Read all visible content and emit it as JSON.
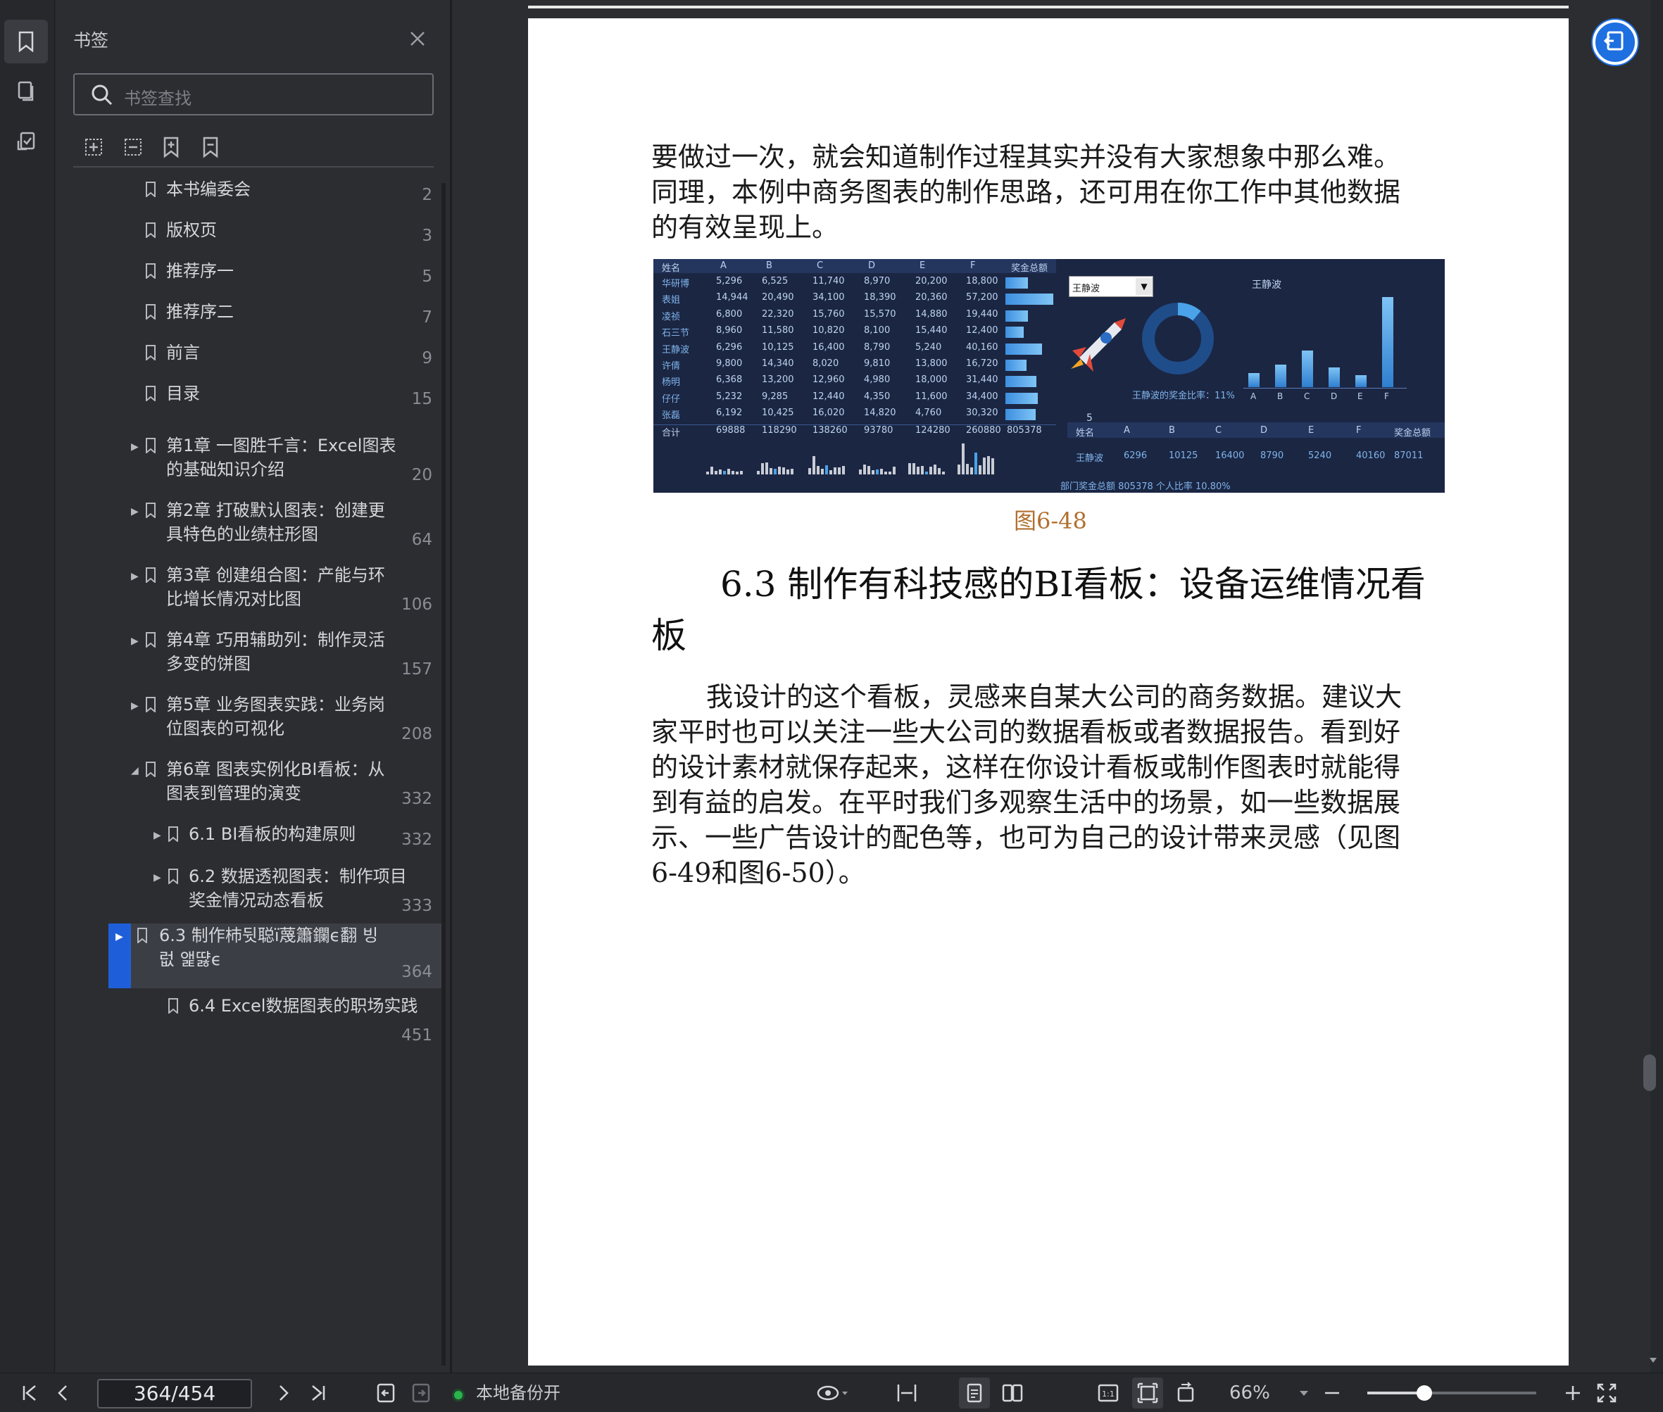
{
  "sidebar": {
    "title": "书签",
    "search_placeholder": "书签查找",
    "items": [
      {
        "label": "本书编委会",
        "page": "2"
      },
      {
        "label": "版权页",
        "page": "3"
      },
      {
        "label": "推荐序一",
        "page": "5"
      },
      {
        "label": "推荐序二",
        "page": "7"
      },
      {
        "label": "前言",
        "page": "9"
      },
      {
        "label": "目录",
        "page": "15"
      },
      {
        "label": "第1章 一图胜千言：Excel图表的基础知识介绍",
        "page": "20"
      },
      {
        "label": "第2章 打破默认图表：创建更具特色的业绩柱形图",
        "page": "64"
      },
      {
        "label": "第3章 创建组合图：产能与环比增长情况对比图",
        "page": "106"
      },
      {
        "label": "第4章 巧用辅助列：制作灵活多变的饼图",
        "page": "157"
      },
      {
        "label": "第5章 业务图表实践：业务岗位图表的可视化",
        "page": "208"
      },
      {
        "label": "第6章 图表实例化BI看板：从图表到管理的演变",
        "page": "332"
      },
      {
        "label": "6.1 BI看板的构建原则",
        "page": "332"
      },
      {
        "label": "6.2 数据透视图表：制作项目奖金情况动态看板",
        "page": "333"
      },
      {
        "label": "6.3 制作杮뒷聪ï蔑簫鑭ϵ翻 빙 럾 앭땷ϵ",
        "page": "364"
      },
      {
        "label": "6.4 Excel数据图表的职场实践",
        "page": "451"
      }
    ]
  },
  "document": {
    "para1_lines": [
      "要做过一次，就会知道制作过程其实并没有大家想象中那么难。",
      "同理，本例中商务图表的制作思路，还可用在你工作中其他数据",
      "的有效呈现上。"
    ],
    "figure_caption": "图6-48",
    "heading_line1": "6.3 制作有科技感的BI看板：设备运维情况看",
    "heading_line2": "板",
    "para2_lines": [
      "我设计的这个看板，灵感来自某大公司的商务数据。建议大",
      "家平时也可以关注一些大公司的数据看板或者数据报告。看到好",
      "的设计素材就保存起来，这样在你设计看板或制作图表时就能得",
      "到有益的启发。在平时我们多观察生活中的场景，如一些数据展",
      "示、一些广告设计的配色等，也可为自己的设计带来灵感（见图",
      "6-49和图6-50）。"
    ]
  },
  "figure": {
    "headers": [
      "姓名",
      "A",
      "B",
      "C",
      "D",
      "E",
      "F",
      "奖金总额"
    ],
    "rows": [
      [
        "华研博",
        "5,296",
        "6,525",
        "11,740",
        "8,970",
        "20,200",
        "18,800"
      ],
      [
        "表姐",
        "14,944",
        "20,490",
        "34,100",
        "18,390",
        "20,360",
        "57,200"
      ],
      [
        "凌祯",
        "6,800",
        "22,320",
        "15,760",
        "15,570",
        "14,880",
        "19,440"
      ],
      [
        "石三节",
        "8,960",
        "11,580",
        "10,820",
        "8,100",
        "15,440",
        "12,400"
      ],
      [
        "王静波",
        "6,296",
        "10,125",
        "16,400",
        "8,790",
        "5,240",
        "40,160"
      ],
      [
        "许倩",
        "9,800",
        "14,340",
        "8,020",
        "9,810",
        "13,800",
        "16,720"
      ],
      [
        "杨明",
        "6,368",
        "13,200",
        "12,960",
        "4,980",
        "18,000",
        "31,440"
      ],
      [
        "仔仔",
        "5,232",
        "9,285",
        "12,440",
        "4,350",
        "11,600",
        "34,400"
      ],
      [
        "张磊",
        "6,192",
        "10,425",
        "16,020",
        "14,820",
        "4,760",
        "30,320"
      ]
    ],
    "total": [
      "合计",
      "69888",
      "118290",
      "138260",
      "93780",
      "124280",
      "260880",
      "805378"
    ],
    "dropdown": "王静波",
    "chart_title": "王静波",
    "ratio_label": "王静波的奖金比率：11%",
    "bar_cats": [
      "A",
      "B",
      "C",
      "D",
      "E",
      "F"
    ],
    "bar_vals": [
      6296,
      10125,
      16400,
      8790,
      5240,
      40160
    ],
    "num5": "5",
    "summary_headers": [
      "姓名",
      "A",
      "B",
      "C",
      "D",
      "E",
      "F",
      "奖金总额"
    ],
    "summary_row": [
      "王静波",
      "6296",
      "10125",
      "16400",
      "8790",
      "5240",
      "40160",
      "87011"
    ],
    "footer": "部门奖金总额 805378    个人比率   10.80%"
  },
  "statusbar": {
    "page_indicator": "364/454",
    "backup_label": "本地备份开",
    "zoom": "66%"
  },
  "colors": {
    "accent": "#1e6fe0",
    "selection": "#1e5fd9",
    "backup_dot": "#2bb34d"
  }
}
